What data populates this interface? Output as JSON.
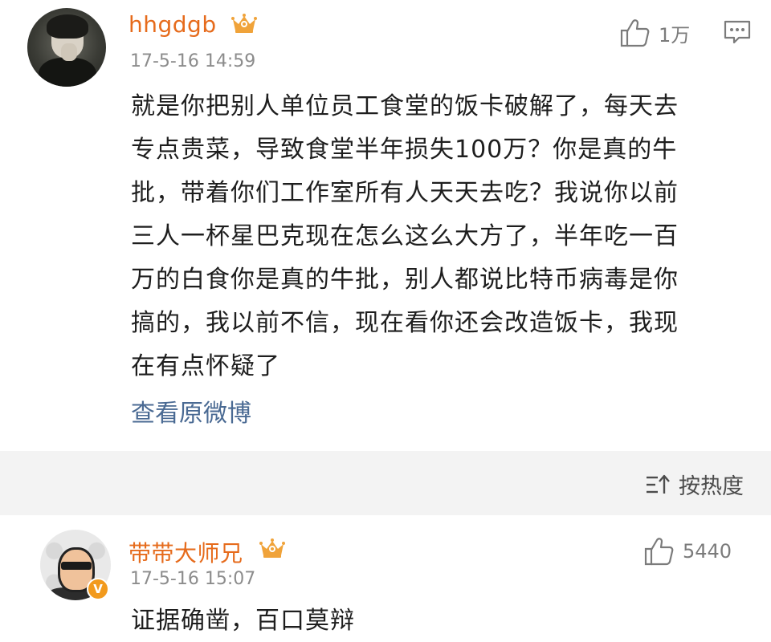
{
  "comments": [
    {
      "username": "hhgdgb",
      "timestamp": "17-5-16 14:59",
      "likes": "1万",
      "avatar_icon": "user-avatar-icon",
      "badge_icon": "crown-icon",
      "lines": [
        "就是你把别人单位员工食堂的饭卡破解了，每天去",
        "专点贵菜，导致食堂半年损失100万？你是真的牛",
        "批，带着你们工作室所有人天天去吃？我说你以前",
        "三人一杯星巴克现在怎么这么大方了，半年吃一百",
        "万的白食你是真的牛批，别人都说比特币病毒是你",
        "搞的，我以前不信，现在看你还会改造饭卡，我现",
        "在有点怀疑了"
      ],
      "view_original": "查看原微博"
    },
    {
      "username": "带带大师兄",
      "timestamp": "17-5-16 15:07",
      "likes": "5440",
      "avatar_icon": "user-avatar-icon",
      "badge_icon": "crown-icon",
      "verified": "V",
      "body": "证据确凿，百口莫辩"
    }
  ],
  "sort": {
    "label": "按热度",
    "icon": "sort-icon"
  },
  "colors": {
    "username": "#e66b1c",
    "link": "#4a6a93",
    "timestamp": "#8c8c8c",
    "crown": "#f0a33a",
    "section_bg": "#f3f3f3",
    "verified": "#f29a1d"
  }
}
